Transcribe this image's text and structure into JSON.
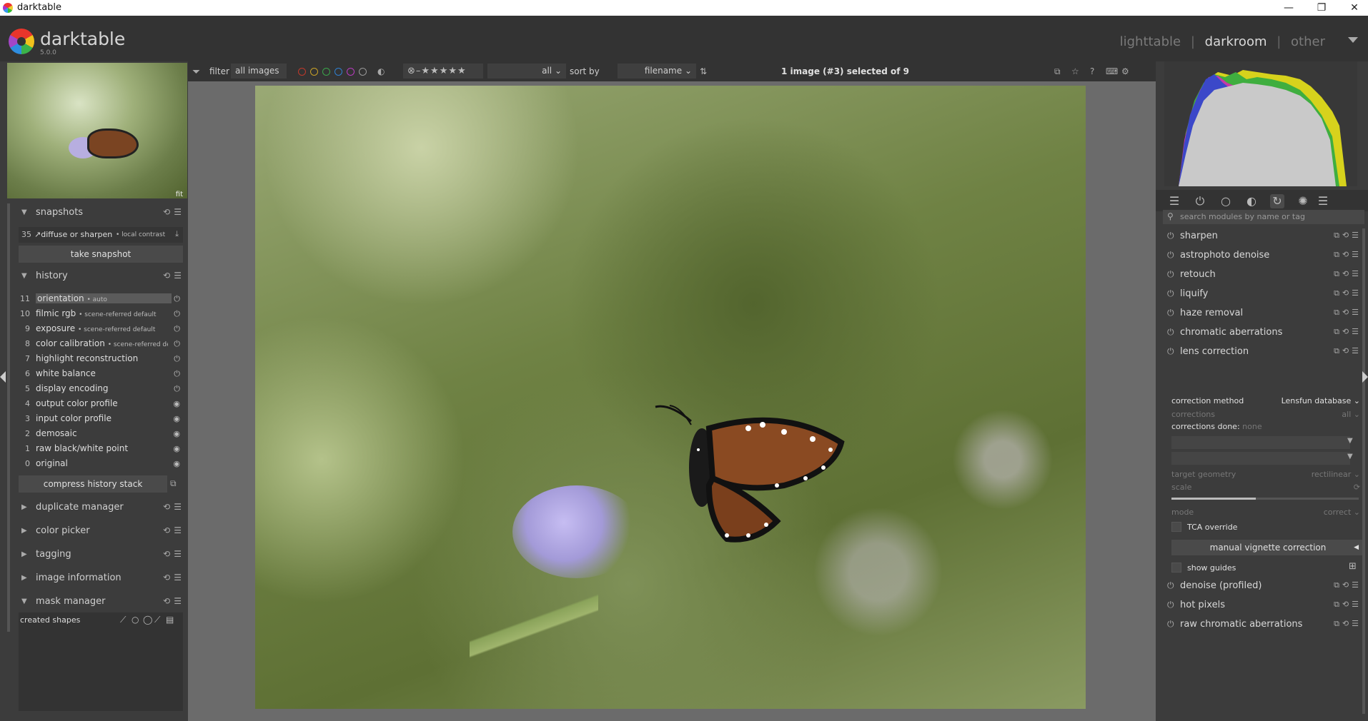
{
  "window": {
    "title": "darktable"
  },
  "header": {
    "app_name": "darktable",
    "version": "5.0.0",
    "views": {
      "lighttable": "lighttable",
      "darkroom": "darkroom",
      "other": "other",
      "separator": "|"
    }
  },
  "navigation": {
    "zoom": "fit"
  },
  "filterbar": {
    "filter_label": "filter",
    "filter_value": "all images",
    "text_search_value": "all",
    "sort_label": "sort by",
    "sort_value": "filename",
    "selection_status": "1 image (#3) selected of 9",
    "color_labels": [
      "#c0392b",
      "#c9a227",
      "#3aa54a",
      "#2f7fd0",
      "#b83bbf",
      "#9a9a9a"
    ]
  },
  "left": {
    "snapshots": {
      "title": "snapshots",
      "entry_num": "35",
      "entry_text": "↗diffuse or sharpen",
      "entry_sub": "• local contrast",
      "button": "take snapshot"
    },
    "history": {
      "title": "history",
      "items": [
        {
          "num": "11",
          "name": "orientation",
          "sub": "• auto"
        },
        {
          "num": "10",
          "name": "filmic rgb",
          "sub": "• scene-referred default"
        },
        {
          "num": "9",
          "name": "exposure",
          "sub": "• scene-referred default"
        },
        {
          "num": "8",
          "name": "color calibration",
          "sub": "• scene-referred def..."
        },
        {
          "num": "7",
          "name": "highlight reconstruction",
          "sub": ""
        },
        {
          "num": "6",
          "name": "white balance",
          "sub": ""
        },
        {
          "num": "5",
          "name": "display encoding",
          "sub": ""
        },
        {
          "num": "4",
          "name": "output color profile",
          "sub": ""
        },
        {
          "num": "3",
          "name": "input color profile",
          "sub": ""
        },
        {
          "num": "2",
          "name": "demosaic",
          "sub": ""
        },
        {
          "num": "1",
          "name": "raw black/white point",
          "sub": ""
        },
        {
          "num": "0",
          "name": "original",
          "sub": ""
        }
      ],
      "compress_button": "compress history stack"
    },
    "sections": {
      "duplicate": "duplicate manager",
      "colorpicker": "color picker",
      "tagging": "tagging",
      "imageinfo": "image information",
      "maskmanager": "mask manager"
    },
    "mask": {
      "created_shapes": "created shapes"
    }
  },
  "right": {
    "search_placeholder": "search modules by name or tag",
    "modules_top": [
      "sharpen",
      "astrophoto denoise",
      "retouch",
      "liquify",
      "haze removal",
      "chromatic aberrations",
      "lens correction"
    ],
    "lens": {
      "correction_method_label": "correction method",
      "correction_method_value": "Lensfun database",
      "corrections_label": "corrections",
      "corrections_value": "all",
      "corrections_done_label": "corrections done:",
      "corrections_done_value": "none",
      "target_geometry_label": "target geometry",
      "target_geometry_value": "rectilinear",
      "scale_label": "scale",
      "mode_label": "mode",
      "mode_value": "correct",
      "tca_override": "TCA override",
      "manual_vignette": "manual vignette correction",
      "show_guides": "show guides"
    },
    "modules_bottom": [
      "denoise (profiled)",
      "hot pixels",
      "raw chromatic aberrations"
    ]
  }
}
